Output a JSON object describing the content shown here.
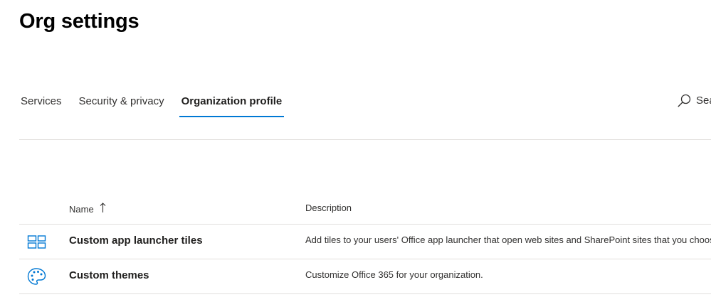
{
  "page": {
    "title": "Org settings"
  },
  "tabs": [
    {
      "label": "Services",
      "active": false
    },
    {
      "label": "Security & privacy",
      "active": false
    },
    {
      "label": "Organization profile",
      "active": true
    }
  ],
  "search": {
    "label": "Sea",
    "icon": "search-icon"
  },
  "table": {
    "columns": {
      "name": "Name",
      "name_sort": "ascending",
      "description": "Description"
    },
    "rows": [
      {
        "icon": "app-launcher-tiles-icon",
        "name": "Custom app launcher tiles",
        "description": "Add tiles to your users' Office app launcher that open web sites and SharePoint sites that you choose."
      },
      {
        "icon": "palette-icon",
        "name": "Custom themes",
        "description": "Customize Office 365 for your organization."
      }
    ]
  },
  "colors": {
    "accent": "#0078d4",
    "divider": "#e1dfdd",
    "text": "#323130"
  }
}
